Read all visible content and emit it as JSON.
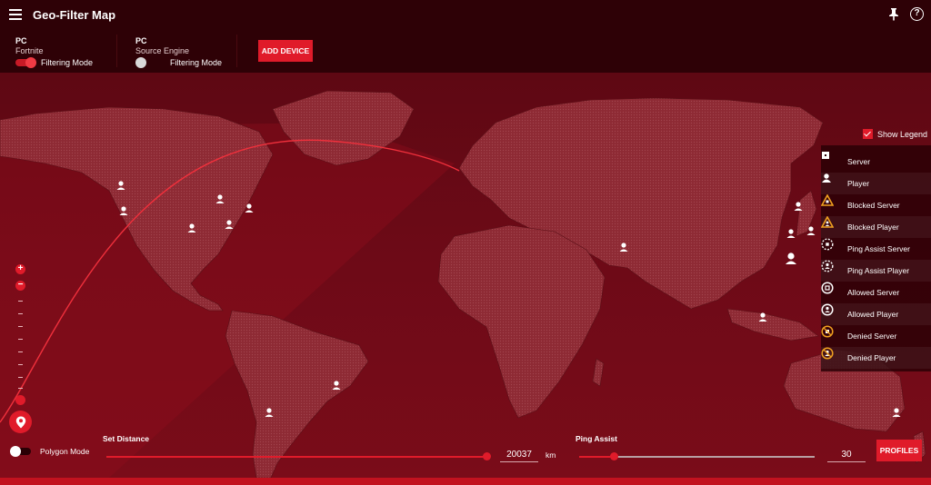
{
  "app": {
    "title": "Geo-Filter Map"
  },
  "devices": [
    {
      "name": "PC",
      "game": "Fortnite",
      "filter_label": "Filtering Mode",
      "filter_on": true
    },
    {
      "name": "PC",
      "game": "Source Engine",
      "filter_label": "Filtering Mode",
      "filter_on": false
    }
  ],
  "toolbar": {
    "add_device_label": "ADD DEVICE"
  },
  "legend": {
    "toggle_label": "Show Legend",
    "show": true,
    "items": [
      {
        "label": "Server",
        "icon": "server-icon"
      },
      {
        "label": "Player",
        "icon": "player-icon"
      },
      {
        "label": "Blocked Server",
        "icon": "blocked-server-icon"
      },
      {
        "label": "Blocked Player",
        "icon": "blocked-player-icon"
      },
      {
        "label": "Ping Assist Server",
        "icon": "ping-assist-server-icon"
      },
      {
        "label": "Ping Assist Player",
        "icon": "ping-assist-player-icon"
      },
      {
        "label": "Allowed Server",
        "icon": "allowed-server-icon"
      },
      {
        "label": "Allowed Player",
        "icon": "allowed-player-icon"
      },
      {
        "label": "Denied Server",
        "icon": "denied-server-icon"
      },
      {
        "label": "Denied Player",
        "icon": "denied-player-icon"
      }
    ]
  },
  "controls": {
    "polygon_mode_label": "Polygon Mode",
    "polygon_mode_on": false,
    "set_distance_label": "Set Distance",
    "distance_value": "20037",
    "distance_unit": "km",
    "distance_fraction": 1.0,
    "ping_assist_label": "Ping Assist",
    "ping_assist_value": "30",
    "ping_assist_fraction": 0.15,
    "profiles_label": "PROFILES"
  },
  "colors": {
    "accent": "#e01b2a",
    "legend_blocked": "#f0a020",
    "background": "#2e0106"
  }
}
